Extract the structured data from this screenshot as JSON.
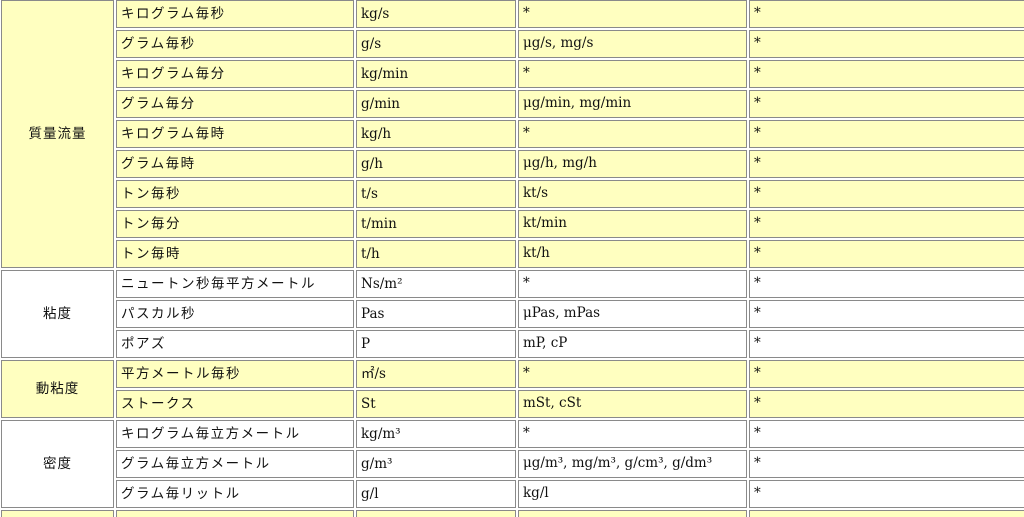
{
  "groups": [
    {
      "category": "質量流量",
      "color": "#ffffc0",
      "rows": [
        {
          "name": "キログラム毎秒",
          "symbol": "kg/s",
          "prefixed": "*",
          "note": "*"
        },
        {
          "name": "グラム毎秒",
          "symbol": "g/s",
          "prefixed": "μg/s, mg/s",
          "note": "*"
        },
        {
          "name": "キログラム毎分",
          "symbol": "kg/min",
          "prefixed": "*",
          "note": "*"
        },
        {
          "name": "グラム毎分",
          "symbol": "g/min",
          "prefixed": "μg/min, mg/min",
          "note": "*"
        },
        {
          "name": "キログラム毎時",
          "symbol": "kg/h",
          "prefixed": "*",
          "note": "*"
        },
        {
          "name": "グラム毎時",
          "symbol": "g/h",
          "prefixed": "μg/h, mg/h",
          "note": "*"
        },
        {
          "name": "トン毎秒",
          "symbol": "t/s",
          "prefixed": "kt/s",
          "note": "*"
        },
        {
          "name": "トン毎分",
          "symbol": "t/min",
          "prefixed": "kt/min",
          "note": "*"
        },
        {
          "name": "トン毎時",
          "symbol": "t/h",
          "prefixed": "kt/h",
          "note": "*"
        }
      ]
    },
    {
      "category": "粘度",
      "color": "#ffffff",
      "rows": [
        {
          "name": "ニュートン秒毎平方メートル",
          "symbol": "Ns/m²",
          "prefixed": "*",
          "note": "*"
        },
        {
          "name": "パスカル秒",
          "symbol": "Pas",
          "prefixed": "μPas, mPas",
          "note": "*"
        },
        {
          "name": "ポアズ",
          "symbol": "P",
          "prefixed": "mP, cP",
          "note": "*"
        }
      ]
    },
    {
      "category": "動粘度",
      "color": "#ffffc0",
      "rows": [
        {
          "name": "平方メートル毎秒",
          "symbol": "㎡/s",
          "prefixed": "*",
          "note": "*"
        },
        {
          "name": "ストークス",
          "symbol": "St",
          "prefixed": "mSt, cSt",
          "note": "*"
        }
      ]
    },
    {
      "category": "密度",
      "color": "#ffffff",
      "rows": [
        {
          "name": "キログラム毎立方メートル",
          "symbol": "kg/m³",
          "prefixed": "*",
          "note": "*"
        },
        {
          "name": "グラム毎立方メートル",
          "symbol": "g/m³",
          "prefixed": "μg/m³, mg/m³, g/cm³, g/dm³",
          "note": "*"
        },
        {
          "name": "グラム毎リットル",
          "symbol": "g/l",
          "prefixed": "kg/l",
          "note": "*"
        }
      ]
    }
  ]
}
